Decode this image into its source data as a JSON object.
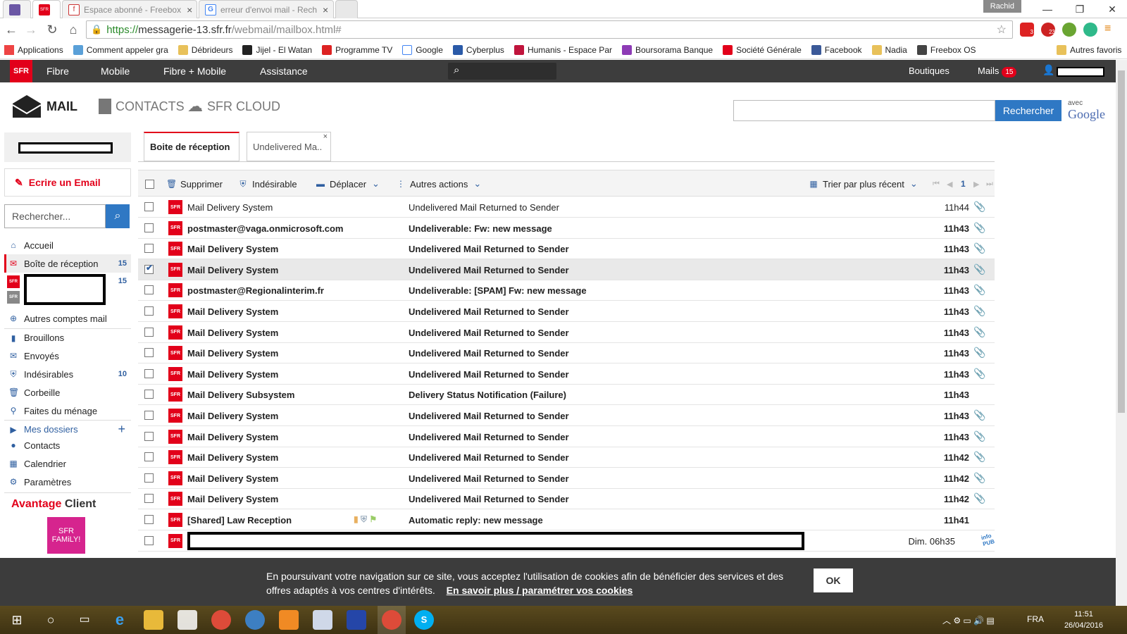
{
  "browser": {
    "tabs": [
      {
        "title": ""
      },
      {
        "title": ""
      },
      {
        "title": "Espace abonné - Freebox"
      },
      {
        "title": "erreur d'envoi mail - Rech"
      }
    ],
    "profile": "Rachid",
    "url": {
      "scheme": "https://",
      "host": "messagerie-13.sfr.fr",
      "path": "/webmail/mailbox.html#"
    },
    "bookmarks": [
      "Applications",
      "Comment appeler gra",
      "Débrideurs",
      "Jijel - El Watan",
      "Programme TV",
      "Google",
      "Cyberplus",
      "Humanis - Espace Par",
      "Boursorama Banque",
      "Société Générale",
      "Facebook",
      "Nadia",
      "Freebox OS",
      "Autres favoris"
    ],
    "ext_badges": [
      "3",
      "23"
    ]
  },
  "sfr_header": {
    "logo": "SFR",
    "nav": [
      "Fibre",
      "Mobile",
      "Fibre + Mobile",
      "Assistance"
    ],
    "boutiques": "Boutiques",
    "mails_label": "Mails",
    "mails_count": "15"
  },
  "app": {
    "tabs": [
      "MAIL",
      "CONTACTS",
      "SFR CLOUD"
    ],
    "search_button": "Rechercher",
    "avec": "avec",
    "google": "Google"
  },
  "sidebar": {
    "write": "Ecrire un Email",
    "search_placeholder": "Rechercher...",
    "items": [
      {
        "label": "Accueil",
        "count": "",
        "icon": "home-icon"
      },
      {
        "label": "Boîte de réception",
        "count": "15",
        "icon": "inbox-icon"
      },
      {
        "label": "",
        "count": "15",
        "icon": "sfr-account-icon"
      },
      {
        "label": "Autres comptes mail",
        "count": "",
        "icon": "plus-circle-icon"
      },
      {
        "label": "Brouillons",
        "count": "",
        "icon": "draft-icon"
      },
      {
        "label": "Envoyés",
        "count": "",
        "icon": "sent-icon"
      },
      {
        "label": "Indésirables",
        "count": "10",
        "icon": "shield-icon"
      },
      {
        "label": "Corbeille",
        "count": "",
        "icon": "trash-icon"
      },
      {
        "label": "Faites du ménage",
        "count": "",
        "icon": "broom-icon"
      },
      {
        "label": "Mes dossiers",
        "count": "",
        "icon": "folder-arrow-icon"
      },
      {
        "label": "Contacts",
        "count": "",
        "icon": "user-icon"
      },
      {
        "label": "Calendrier",
        "count": "",
        "icon": "calendar-icon"
      },
      {
        "label": "Paramètres",
        "count": "",
        "icon": "gear-icon"
      }
    ],
    "avantage_a": "Avantage",
    "avantage_b": "Client",
    "family": "SFR FAMiLY!"
  },
  "mail_tabs": [
    "Boite de réception",
    "Undelivered Ma.."
  ],
  "toolbar": {
    "delete": "Supprimer",
    "spam": "Indésirable",
    "move": "Déplacer",
    "other": "Autres actions",
    "sort": "Trier par plus récent",
    "page": "1"
  },
  "emails": [
    {
      "from": "Mail Delivery System",
      "subject": "Undelivered Mail Returned to Sender",
      "time": "11h44",
      "bold": false,
      "selected": false,
      "attach": true
    },
    {
      "from": "postmaster@vaga.onmicrosoft.com",
      "subject": "Undeliverable: Fw: new message",
      "time": "11h43",
      "bold": true,
      "selected": false,
      "attach": true
    },
    {
      "from": "Mail Delivery System",
      "subject": "Undelivered Mail Returned to Sender",
      "time": "11h43",
      "bold": true,
      "selected": false,
      "attach": true
    },
    {
      "from": "Mail Delivery System",
      "subject": "Undelivered Mail Returned to Sender",
      "time": "11h43",
      "bold": true,
      "selected": true,
      "attach": true
    },
    {
      "from": "postmaster@Regionalinterim.fr",
      "subject": "Undeliverable: [SPAM] Fw: new message",
      "time": "11h43",
      "bold": true,
      "selected": false,
      "attach": true
    },
    {
      "from": "Mail Delivery System",
      "subject": "Undelivered Mail Returned to Sender",
      "time": "11h43",
      "bold": true,
      "selected": false,
      "attach": true
    },
    {
      "from": "Mail Delivery System",
      "subject": "Undelivered Mail Returned to Sender",
      "time": "11h43",
      "bold": true,
      "selected": false,
      "attach": true
    },
    {
      "from": "Mail Delivery System",
      "subject": "Undelivered Mail Returned to Sender",
      "time": "11h43",
      "bold": true,
      "selected": false,
      "attach": true
    },
    {
      "from": "Mail Delivery System",
      "subject": "Undelivered Mail Returned to Sender",
      "time": "11h43",
      "bold": true,
      "selected": false,
      "attach": true
    },
    {
      "from": "Mail Delivery Subsystem",
      "subject": "Delivery Status Notification (Failure)",
      "time": "11h43",
      "bold": true,
      "selected": false,
      "attach": false
    },
    {
      "from": "Mail Delivery System",
      "subject": "Undelivered Mail Returned to Sender",
      "time": "11h43",
      "bold": true,
      "selected": false,
      "attach": true
    },
    {
      "from": "Mail Delivery System",
      "subject": "Undelivered Mail Returned to Sender",
      "time": "11h43",
      "bold": true,
      "selected": false,
      "attach": true
    },
    {
      "from": "Mail Delivery System",
      "subject": "Undelivered Mail Returned to Sender",
      "time": "11h42",
      "bold": true,
      "selected": false,
      "attach": true
    },
    {
      "from": "Mail Delivery System",
      "subject": "Undelivered Mail Returned to Sender",
      "time": "11h42",
      "bold": true,
      "selected": false,
      "attach": true
    },
    {
      "from": "Mail Delivery System",
      "subject": "Undelivered Mail Returned to Sender",
      "time": "11h42",
      "bold": true,
      "selected": false,
      "attach": true
    },
    {
      "from": "[Shared] Law Reception",
      "subject": "Automatic reply: new message",
      "time": "11h41",
      "bold": true,
      "selected": false,
      "attach": false
    },
    {
      "from": "",
      "subject": "",
      "time": "Dim. 06h35",
      "bold": false,
      "selected": false,
      "attach": false
    }
  ],
  "ad_label": "info PUB",
  "cookie": {
    "text": "En poursuivant votre navigation sur ce site, vous acceptez l'utilisation de cookies afin de bénéficier des services et des offres adaptés à vos centres d'intérêts.",
    "link": "En savoir plus / paramétrer vos cookies",
    "ok": "OK"
  },
  "taskbar": {
    "lang": "FRA",
    "time": "11:51",
    "date": "26/04/2016"
  },
  "colors": {
    "sfr_red": "#e2001a",
    "accent_blue": "#2f78c4",
    "header_dark": "#3d3d3d"
  }
}
